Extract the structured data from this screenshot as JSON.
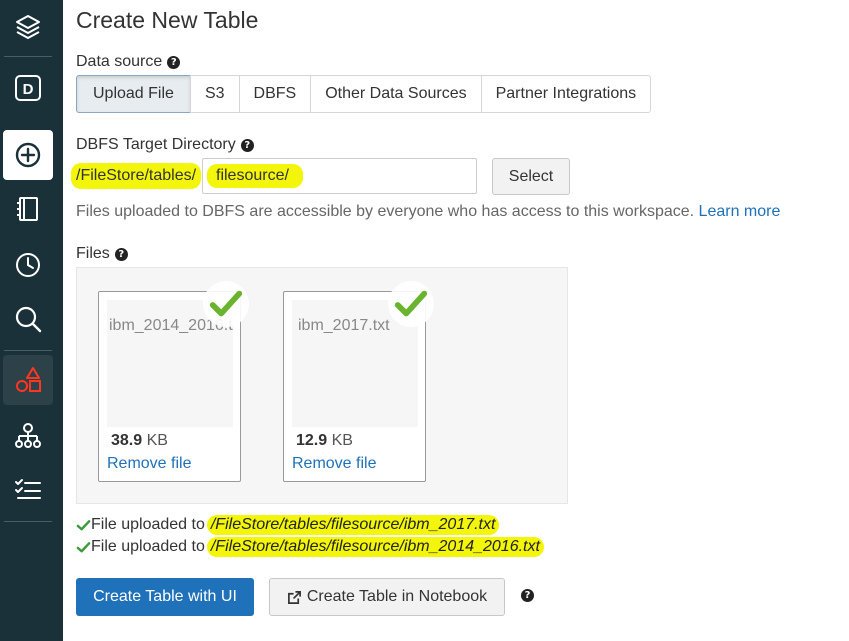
{
  "sidebar": {
    "items": [
      {
        "icon": "layers-icon"
      },
      {
        "icon": "dashboard-d-icon",
        "letter": "D"
      },
      {
        "icon": "create-plus-icon"
      },
      {
        "icon": "notebook-icon"
      },
      {
        "icon": "clock-icon"
      },
      {
        "icon": "search-icon"
      },
      {
        "icon": "shapes-icon"
      },
      {
        "icon": "cluster-icon"
      },
      {
        "icon": "jobs-checklist-icon"
      }
    ]
  },
  "page": {
    "title": "Create New Table"
  },
  "data_source": {
    "label": "Data source",
    "tabs": [
      {
        "label": "Upload File",
        "active": true
      },
      {
        "label": "S3",
        "active": false
      },
      {
        "label": "DBFS",
        "active": false
      },
      {
        "label": "Other Data Sources",
        "active": false
      },
      {
        "label": "Partner Integrations",
        "active": false
      }
    ]
  },
  "dbfs_target": {
    "label": "DBFS Target Directory",
    "prefix": "/FileStore/tables/",
    "value": "filesource/",
    "select_label": "Select",
    "info_text": "Files uploaded to DBFS are accessible by everyone who has access to this workspace.",
    "learn_more": "Learn more"
  },
  "files": {
    "label": "Files",
    "items": [
      {
        "name": "ibm_2014_2016.txt",
        "size_value": "38.9",
        "size_unit": "KB",
        "remove_label": "Remove file"
      },
      {
        "name": "ibm_2017.txt",
        "size_value": "12.9",
        "size_unit": "KB",
        "remove_label": "Remove file"
      }
    ]
  },
  "upload_status": [
    {
      "text": "File uploaded to",
      "path": "/FileStore/tables/filesource/ibm_2017.txt"
    },
    {
      "text": "File uploaded to",
      "path": "/FileStore/tables/filesource/ibm_2014_2016.txt"
    }
  ],
  "actions": {
    "create_ui": "Create Table with UI",
    "create_notebook": "Create Table in Notebook"
  },
  "colors": {
    "sidebar_bg": "#1b3139",
    "accent_blue": "#1f71ba",
    "highlight_yellow": "#f3f50a",
    "check_green": "#6ab42d",
    "shapes_red": "#ff3621"
  }
}
